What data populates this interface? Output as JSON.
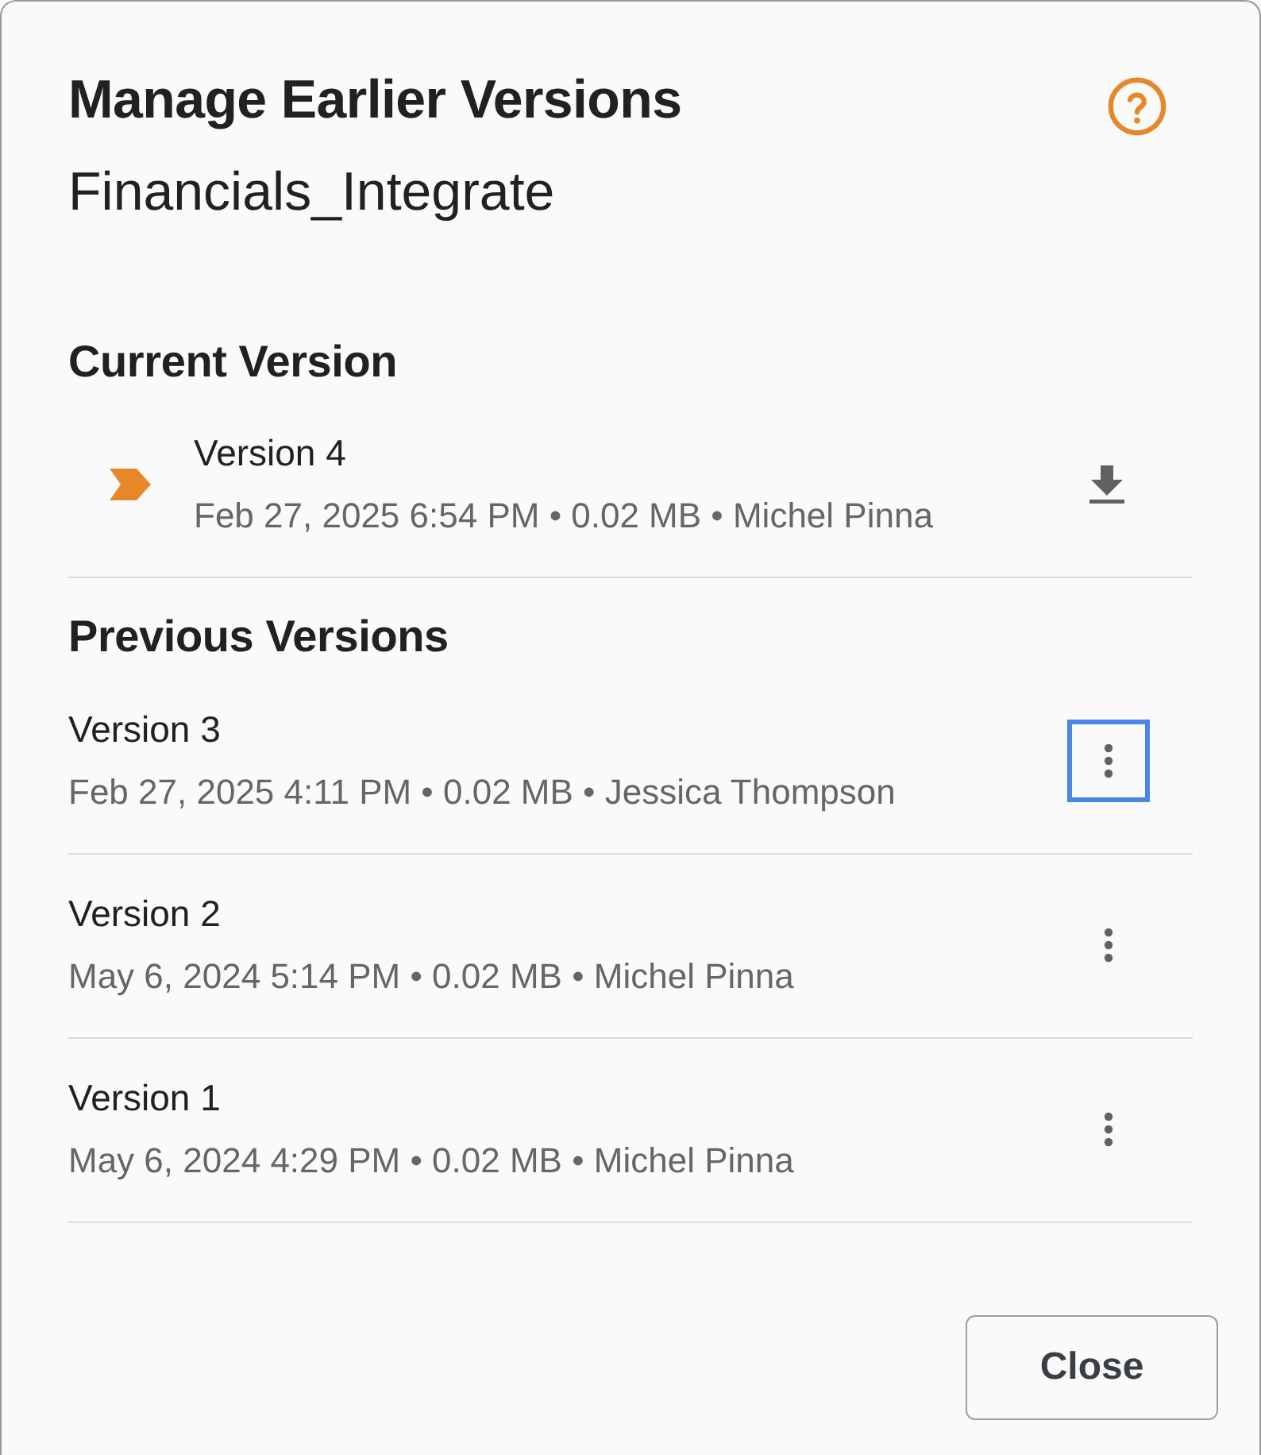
{
  "dialog": {
    "title": "Manage Earlier Versions",
    "file_name": "Financials_Integrate"
  },
  "current_section": {
    "heading": "Current Version",
    "version": {
      "name": "Version 4",
      "details": "Feb 27, 2025 6:54 PM • 0.02 MB • Michel Pinna"
    }
  },
  "previous_section": {
    "heading": "Previous Versions",
    "versions": [
      {
        "name": "Version 3",
        "details": "Feb 27, 2025 4:11 PM • 0.02 MB • Jessica Thompson",
        "menu_focused": true
      },
      {
        "name": "Version 2",
        "details": "May 6, 2024 5:14 PM • 0.02 MB • Michel Pinna",
        "menu_focused": false
      },
      {
        "name": "Version 1",
        "details": "May 6, 2024 4:29 PM • 0.02 MB • Michel Pinna",
        "menu_focused": false
      }
    ]
  },
  "buttons": [
    "Close"
  ]
}
